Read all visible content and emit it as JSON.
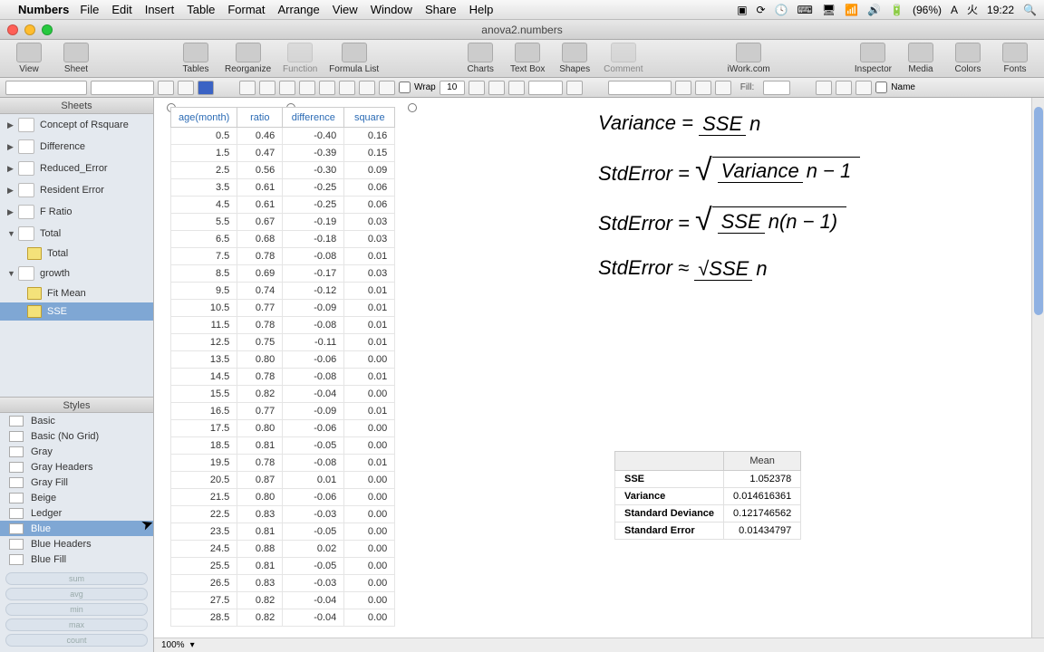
{
  "menubar": {
    "app": "Numbers",
    "items": [
      "File",
      "Edit",
      "Insert",
      "Table",
      "Format",
      "Arrange",
      "View",
      "Window",
      "Share",
      "Help"
    ],
    "right": {
      "battery": "(96%)",
      "day": "火",
      "time": "19:22"
    }
  },
  "window": {
    "title": "anova2.numbers"
  },
  "toolbar": {
    "left": [
      "View",
      "Sheet"
    ],
    "group1": [
      "Tables",
      "Reorganize",
      "Function",
      "Formula List"
    ],
    "group2": [
      "Charts",
      "Text Box",
      "Shapes",
      "Comment"
    ],
    "center": "iWork.com",
    "right": [
      "Inspector",
      "Media",
      "Colors",
      "Fonts"
    ]
  },
  "formatbar": {
    "wrap": "Wrap",
    "font_size": "10",
    "fill": "Fill:",
    "name": "Name"
  },
  "sidebar": {
    "sheets_label": "Sheets",
    "sheets": [
      {
        "name": "Concept of Rsquare",
        "type": "sheet"
      },
      {
        "name": "Difference",
        "type": "sheet"
      },
      {
        "name": "Reduced_Error",
        "type": "sheet"
      },
      {
        "name": "Resident Error",
        "type": "sheet"
      },
      {
        "name": "F Ratio",
        "type": "sheet"
      },
      {
        "name": "Total",
        "type": "sheet",
        "expanded": true,
        "tables": [
          {
            "name": "Total"
          }
        ]
      },
      {
        "name": "growth",
        "type": "sheet",
        "expanded": true,
        "tables": [
          {
            "name": "Fit Mean"
          },
          {
            "name": "SSE",
            "selected": true
          }
        ]
      }
    ],
    "styles_label": "Styles",
    "styles": [
      "Basic",
      "Basic (No Grid)",
      "Gray",
      "Gray Headers",
      "Gray Fill",
      "Beige",
      "Ledger",
      "Blue",
      "Blue Headers",
      "Blue Fill"
    ],
    "style_selected": "Blue",
    "calc": [
      "sum",
      "avg",
      "min",
      "max",
      "count"
    ]
  },
  "table": {
    "headers": [
      "age(month)",
      "ratio",
      "difference",
      "square"
    ],
    "rows": [
      [
        "0.5",
        "0.46",
        "-0.40",
        "0.16"
      ],
      [
        "1.5",
        "0.47",
        "-0.39",
        "0.15"
      ],
      [
        "2.5",
        "0.56",
        "-0.30",
        "0.09"
      ],
      [
        "3.5",
        "0.61",
        "-0.25",
        "0.06"
      ],
      [
        "4.5",
        "0.61",
        "-0.25",
        "0.06"
      ],
      [
        "5.5",
        "0.67",
        "-0.19",
        "0.03"
      ],
      [
        "6.5",
        "0.68",
        "-0.18",
        "0.03"
      ],
      [
        "7.5",
        "0.78",
        "-0.08",
        "0.01"
      ],
      [
        "8.5",
        "0.69",
        "-0.17",
        "0.03"
      ],
      [
        "9.5",
        "0.74",
        "-0.12",
        "0.01"
      ],
      [
        "10.5",
        "0.77",
        "-0.09",
        "0.01"
      ],
      [
        "11.5",
        "0.78",
        "-0.08",
        "0.01"
      ],
      [
        "12.5",
        "0.75",
        "-0.11",
        "0.01"
      ],
      [
        "13.5",
        "0.80",
        "-0.06",
        "0.00"
      ],
      [
        "14.5",
        "0.78",
        "-0.08",
        "0.01"
      ],
      [
        "15.5",
        "0.82",
        "-0.04",
        "0.00"
      ],
      [
        "16.5",
        "0.77",
        "-0.09",
        "0.01"
      ],
      [
        "17.5",
        "0.80",
        "-0.06",
        "0.00"
      ],
      [
        "18.5",
        "0.81",
        "-0.05",
        "0.00"
      ],
      [
        "19.5",
        "0.78",
        "-0.08",
        "0.01"
      ],
      [
        "20.5",
        "0.87",
        "0.01",
        "0.00"
      ],
      [
        "21.5",
        "0.80",
        "-0.06",
        "0.00"
      ],
      [
        "22.5",
        "0.83",
        "-0.03",
        "0.00"
      ],
      [
        "23.5",
        "0.81",
        "-0.05",
        "0.00"
      ],
      [
        "24.5",
        "0.88",
        "0.02",
        "0.00"
      ],
      [
        "25.5",
        "0.81",
        "-0.05",
        "0.00"
      ],
      [
        "26.5",
        "0.83",
        "-0.03",
        "0.00"
      ],
      [
        "27.5",
        "0.82",
        "-0.04",
        "0.00"
      ],
      [
        "28.5",
        "0.82",
        "-0.04",
        "0.00"
      ]
    ]
  },
  "formulas": {
    "f1a": "Variance =",
    "f1_num": "SSE",
    "f1_den": "n",
    "f2a": "StdError =",
    "f2_num": "Variance",
    "f2_den": "n − 1",
    "f3a": "StdError =",
    "f3_num": "SSE",
    "f3_den": "n(n − 1)",
    "f4a": "StdError ≈",
    "f4_num": "√SSE",
    "f4_den": "n"
  },
  "stats": {
    "header": "Mean",
    "rows": [
      {
        "label": "SSE",
        "value": "1.052378"
      },
      {
        "label": "Variance",
        "value": "0.014616361"
      },
      {
        "label": "Standard Deviance",
        "value": "0.121746562"
      },
      {
        "label": "Standard Error",
        "value": "0.01434797"
      }
    ]
  },
  "statusbar": {
    "zoom": "100%"
  }
}
